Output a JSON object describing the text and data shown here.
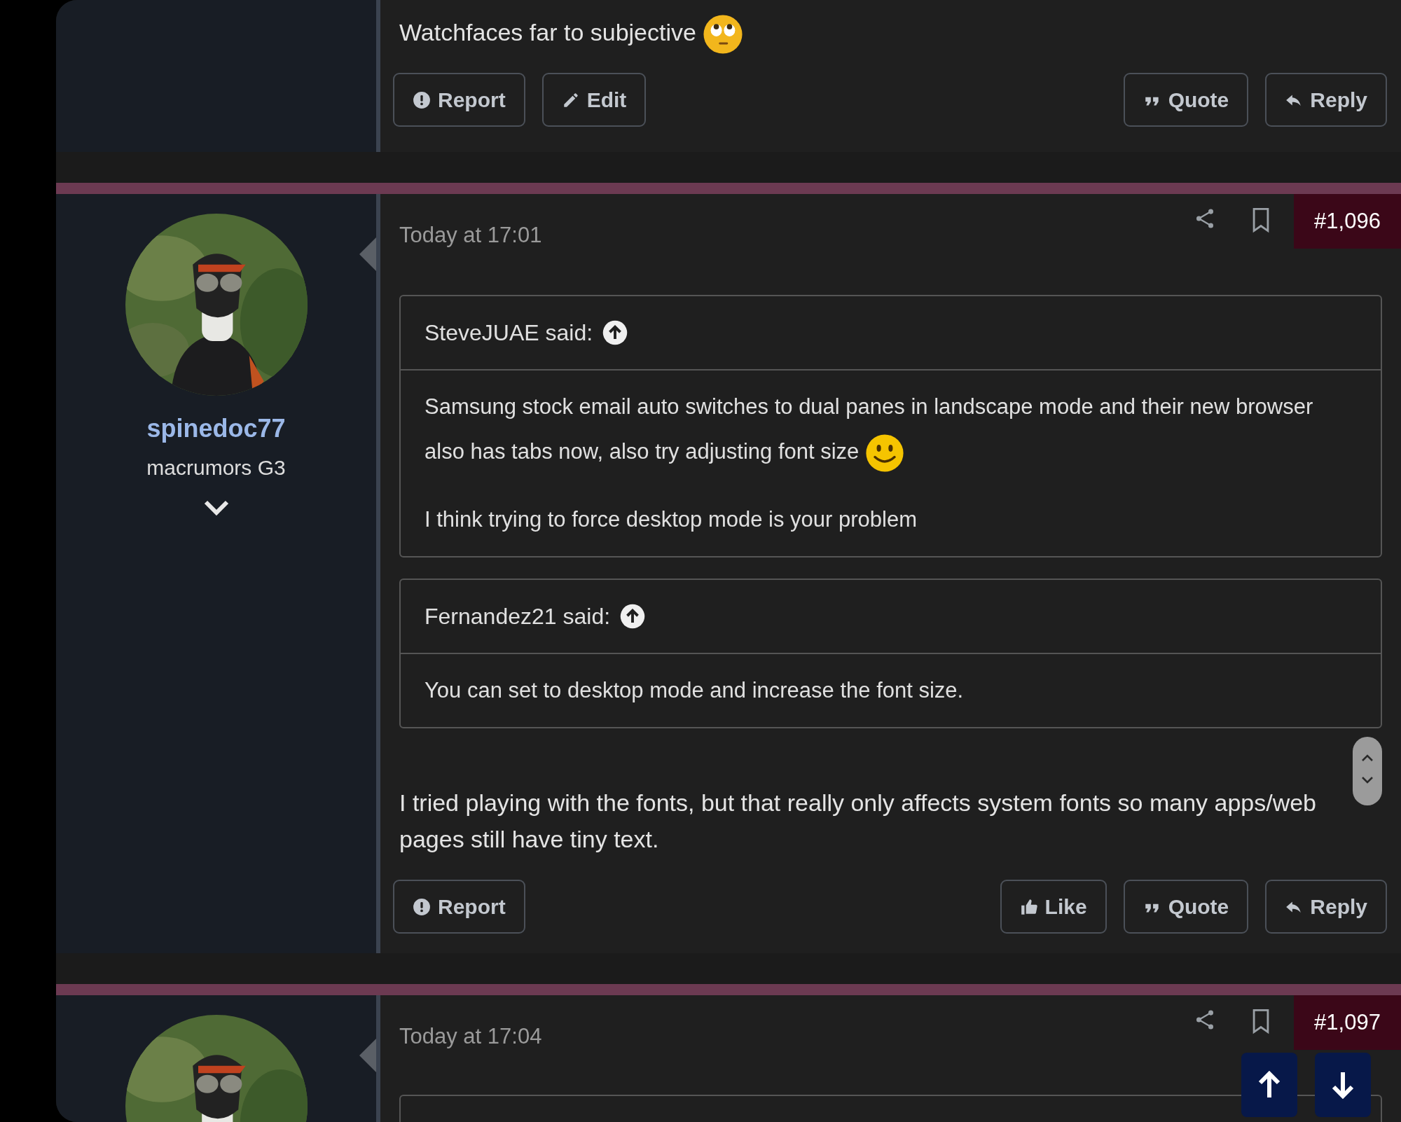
{
  "posts": [
    {
      "kind": "tail",
      "body": {
        "text": "Watchfaces far to subjective",
        "kind": "eyeroll"
      },
      "actions_left": [
        {
          "label": "Report",
          "kind": "report"
        },
        {
          "label": "Edit",
          "kind": "edit"
        }
      ],
      "actions_right": [
        {
          "label": "Quote",
          "kind": "quote"
        },
        {
          "label": "Reply",
          "kind": "reply"
        }
      ]
    },
    {
      "kind": "full",
      "author": "spinedoc77",
      "user_title": "macrumors G3",
      "date": "Today at 17:01",
      "number": "#1,096",
      "quotes": [
        {
          "author": "SteveJUAE said:",
          "paragraphs": [
            {
              "text": "Samsung stock email auto switches to dual panes in landscape mode and their new browser also has tabs now, also try adjusting font size",
              "kind": "smile"
            },
            {
              "text": "I think trying to force desktop mode is your problem",
              "kind": "plain"
            }
          ]
        },
        {
          "author": "Fernandez21 said:",
          "paragraphs": [
            {
              "text": "You can set to desktop mode and increase the font size.",
              "kind": "plain"
            }
          ]
        }
      ],
      "text": "I tried playing with the fonts, but that really only affects system fonts so many apps/web pages still have tiny text.",
      "actions_left": [
        {
          "label": "Report",
          "kind": "report"
        }
      ],
      "actions_right": [
        {
          "label": "Like",
          "kind": "like"
        },
        {
          "label": "Quote",
          "kind": "quote"
        },
        {
          "label": "Reply",
          "kind": "reply"
        }
      ]
    },
    {
      "kind": "head",
      "date": "Today at 17:04",
      "number": "#1,097"
    }
  ]
}
